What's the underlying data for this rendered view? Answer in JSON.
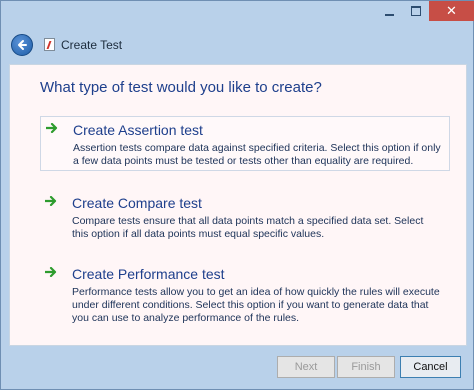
{
  "window": {
    "title": "Create Test",
    "controls": {
      "minimize": "",
      "maximize": "",
      "close": "✕"
    }
  },
  "main": {
    "question": "What type of test would you like to create?",
    "options": [
      {
        "title": "Create Assertion test",
        "description": "Assertion tests compare data against specified criteria. Select this option if only a few data points must be tested or tests other than equality are required.",
        "selected": true
      },
      {
        "title": "Create Compare test",
        "description": "Compare tests ensure that all data points match a specified data set. Select this option if all data points must equal specific values.",
        "selected": false
      },
      {
        "title": "Create Performance test",
        "description": "Performance tests allow you to get an idea of how quickly the rules will execute under different conditions. Select this option if you want to generate data that you can use to analyze performance of the rules.",
        "selected": false
      }
    ]
  },
  "footer": {
    "next_label": "Next",
    "finish_label": "Finish",
    "cancel_label": "Cancel"
  },
  "icons": {
    "back": "back-arrow-icon",
    "app": "create-test-icon",
    "option_arrow": "green-arrow-icon"
  },
  "colors": {
    "heading_blue": "#1e3f8c",
    "arrow_green": "#2e9c2e",
    "close_red": "#c74e46"
  }
}
